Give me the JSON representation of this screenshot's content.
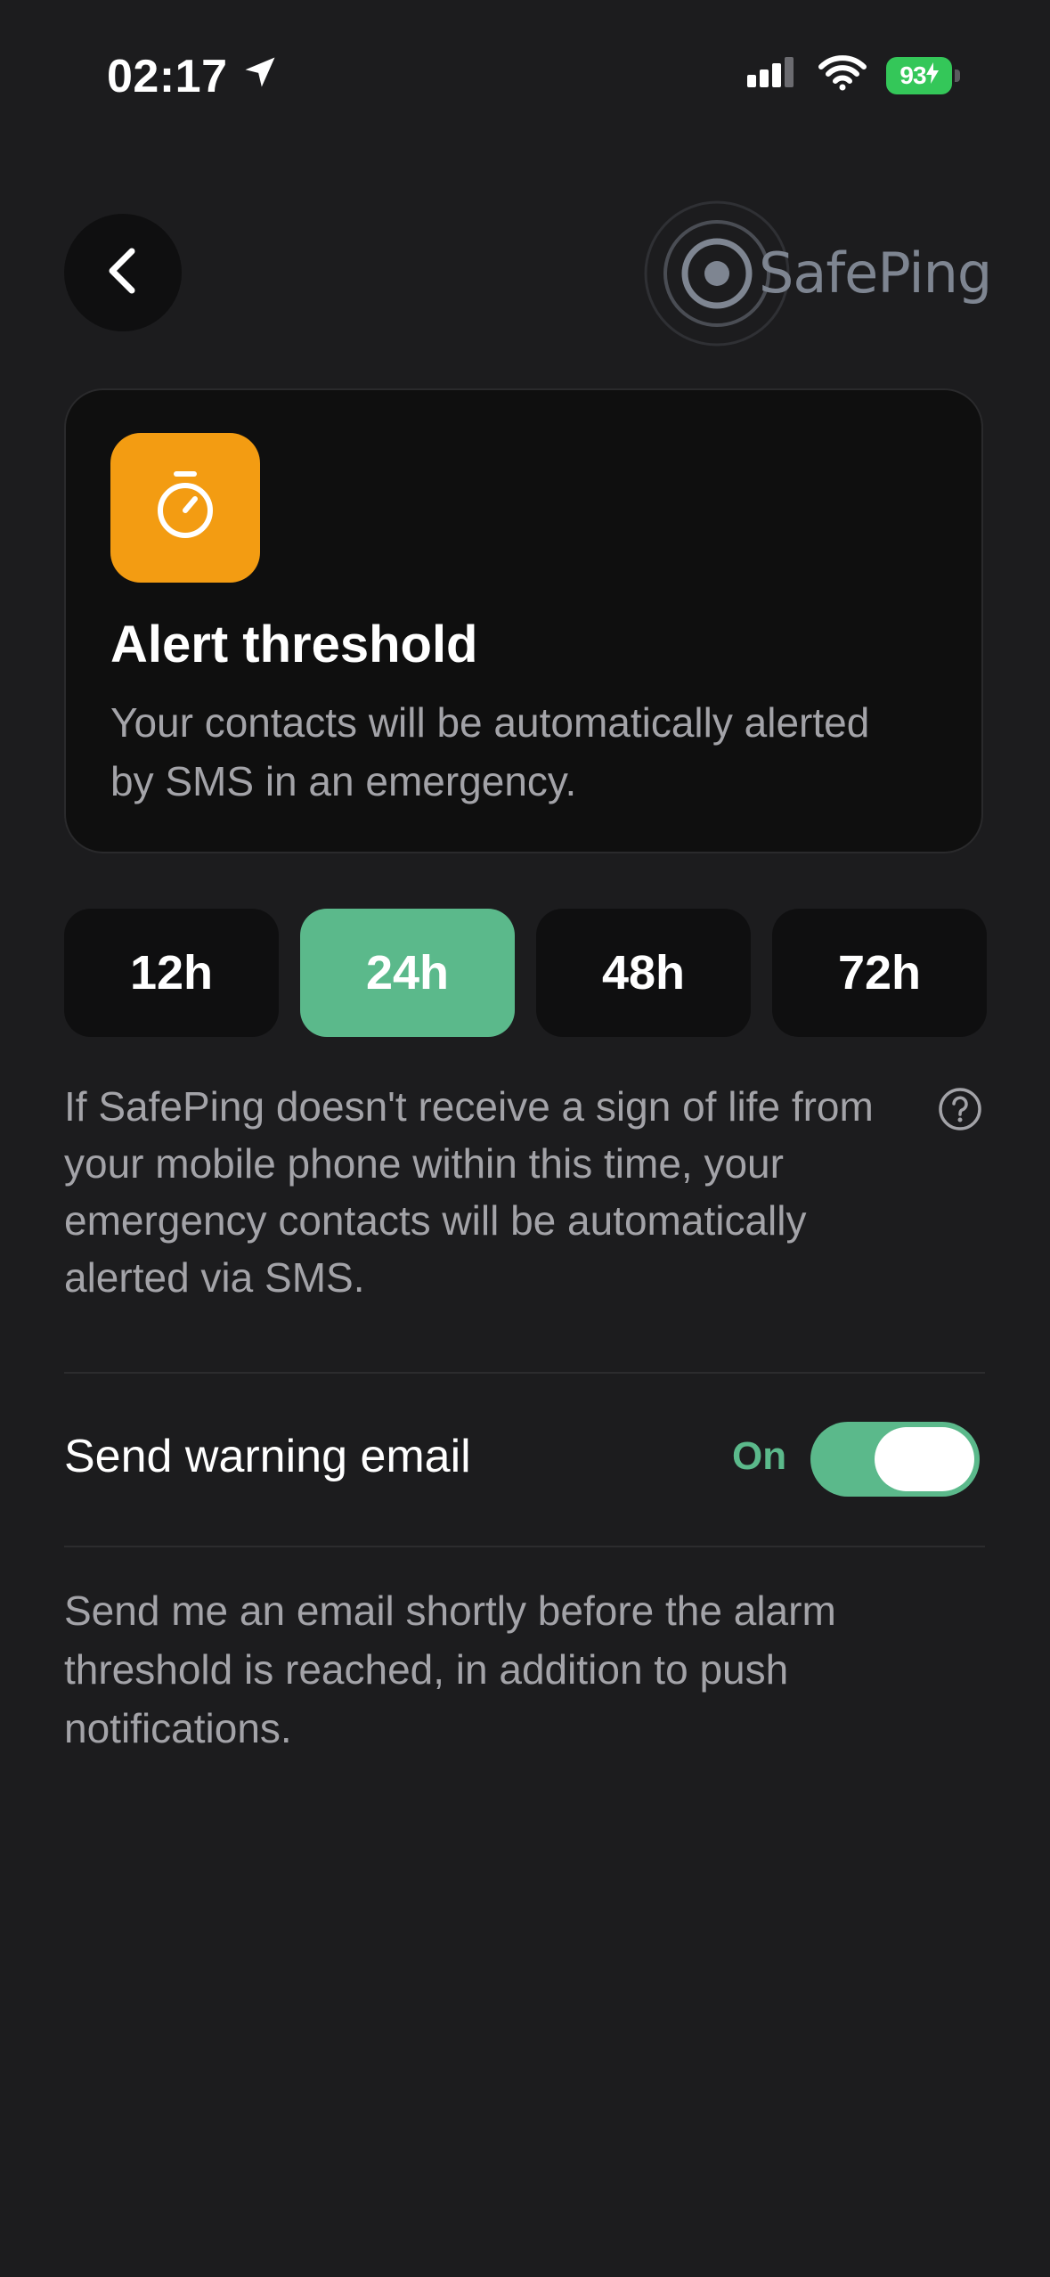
{
  "status_bar": {
    "time": "02:17",
    "battery": "93"
  },
  "header": {
    "logo_text": "SafePing"
  },
  "card": {
    "icon": "stopwatch-icon",
    "icon_color": "#f39c12",
    "title": "Alert threshold",
    "description": "Your contacts will be automatically alerted by SMS in an emergency."
  },
  "threshold_options": [
    {
      "label": "12h",
      "selected": false
    },
    {
      "label": "24h",
      "selected": true
    },
    {
      "label": "48h",
      "selected": false
    },
    {
      "label": "72h",
      "selected": false
    }
  ],
  "info_text": "If SafePing doesn't receive a sign of life from your mobile phone within this time, your emergency contacts will be automatically alerted via SMS.",
  "email_setting": {
    "label": "Send warning email",
    "status": "On",
    "enabled": true,
    "description": "Send me an email shortly before the alarm threshold is reached, in addition to push notifications."
  },
  "colors": {
    "accent_green": "#5bb98b",
    "background": "#1c1c1e",
    "card_background": "#0f0f0f",
    "battery_green": "#34c759"
  }
}
